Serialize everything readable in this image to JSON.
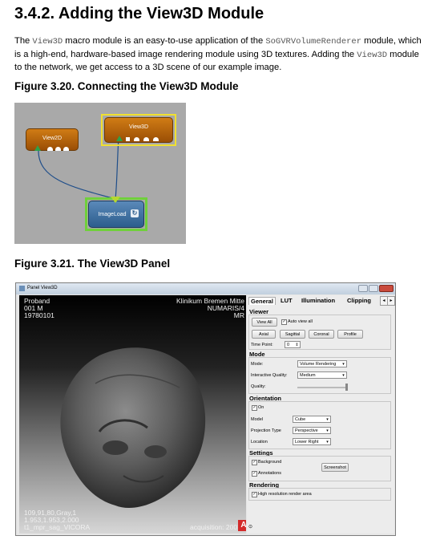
{
  "heading": "3.4.2. Adding the View3D Module",
  "intro": {
    "l1a": "The ",
    "l1b": "View3D",
    "l1c": " macro module is an easy-to-use application of the ",
    "l1d": "SoGVRVolumeRenderer",
    "l1e": " module, which",
    "l2a": "is a high-end, hardware-based image rendering module using 3D textures. Adding the ",
    "l2b": "View3D",
    "l2c": " module",
    "l3": "to the network, we get access to a 3D scene of our example image."
  },
  "figure1": {
    "caption": "Figure 3.20. Connecting the View3D Module",
    "modules": {
      "view2d": "View2D",
      "view3d": "View3D",
      "imageload": "ImageLoad"
    }
  },
  "figure2": {
    "caption": "Figure 3.21. The View3D Panel",
    "window_title": "Panel View3D",
    "viewer_text": {
      "tl1": "Proband",
      "tl2": "001 M",
      "tl3": "19780101",
      "tr1": "Klinikum Bremen Mitte",
      "tr2": "NUMARIS/4",
      "tr3": "MR",
      "bl1": "109,91,80,Gray,1",
      "bl2": "1.953,1.953,2.000",
      "bl3": "t1_mpr_sag_VICORA",
      "br": "acquisition: 2007"
    },
    "tabs": [
      "General",
      "LUT",
      "Illumination",
      "Clipping"
    ],
    "viewer_group": {
      "title": "Viewer",
      "view_all_btn": "View All",
      "auto_view_all": "Auto view all",
      "axial": "Axial",
      "sagittal": "Sagittal",
      "coronal": "Coronal",
      "profile": "Profile",
      "time_point_label": "Time Point:",
      "time_point_value": "0"
    },
    "mode_group": {
      "title": "Mode",
      "mode_label": "Mode:",
      "mode_value": "Volume Rendering",
      "iq_label": "Interactive Quality:",
      "iq_value": "Medium",
      "quality_label": "Quality:"
    },
    "orientation_group": {
      "title": "Orientation",
      "on": "On",
      "model_label": "Model",
      "model_value": "Cube",
      "proj_label": "Projection Type",
      "proj_value": "Perspective",
      "location_label": "Location",
      "location_value": "Lower Right"
    },
    "settings_group": {
      "title": "Settings",
      "background": "Background",
      "annotations": "Annotations",
      "screenshot": "Screenshot"
    },
    "rendering_group": {
      "title": "Rendering",
      "hires": "High resolution render area"
    }
  }
}
